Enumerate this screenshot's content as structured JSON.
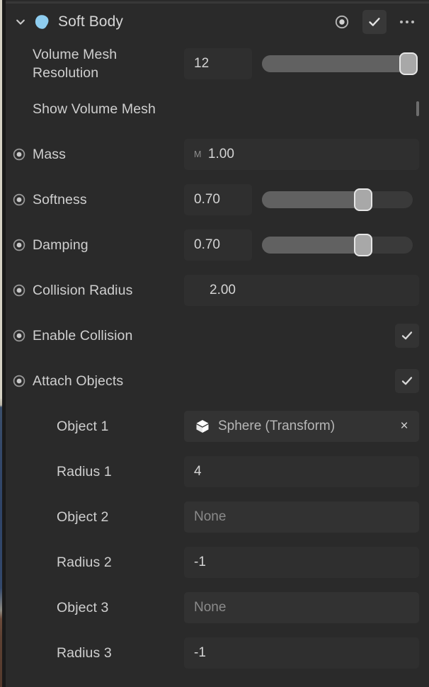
{
  "colors": {
    "panel_bg": "#2a2a2a",
    "field_bg": "#2f2f2f",
    "objfield_bg": "#333333",
    "text": "#cfcfcf",
    "muted_text": "#8b8b8b",
    "accent_icon": "#8ecdf0",
    "slider_fill": "#616161",
    "slider_knob": "#a8a8a8"
  },
  "header": {
    "title": "Soft Body",
    "foldout_state": "expanded",
    "foldout_icon": "chevron-down-icon",
    "component_icon": "soft-body-blob-icon",
    "target_icon": "record-target-icon",
    "enabled_icon": "checkmark-icon",
    "menu_icon": "more-options-icon"
  },
  "properties": [
    {
      "name": "volume-mesh-resolution",
      "label": "Volume Mesh Resolution",
      "control": "number-slider",
      "has_bullet": false,
      "value": "12",
      "slider": {
        "percent": 97
      }
    },
    {
      "name": "show-volume-mesh",
      "label": "Show Volume Mesh",
      "control": "checkbox",
      "has_bullet": false,
      "checked": false
    },
    {
      "name": "mass",
      "label": "Mass",
      "control": "number-unit",
      "has_bullet": true,
      "unit": "M",
      "value": "1.00"
    },
    {
      "name": "softness",
      "label": "Softness",
      "control": "number-slider",
      "has_bullet": true,
      "value": "0.70",
      "slider": {
        "percent": 67
      }
    },
    {
      "name": "damping",
      "label": "Damping",
      "control": "number-slider",
      "has_bullet": true,
      "value": "0.70",
      "slider": {
        "percent": 67
      }
    },
    {
      "name": "collision-radius",
      "label": "Collision Radius",
      "control": "number-wide",
      "has_bullet": true,
      "value": "2.00"
    },
    {
      "name": "enable-collision",
      "label": "Enable Collision",
      "control": "checkmark",
      "has_bullet": true,
      "checked": true
    },
    {
      "name": "attach-objects",
      "label": "Attach Objects",
      "control": "checkmark",
      "has_bullet": true,
      "checked": true
    },
    {
      "name": "object-1",
      "label": "Object 1",
      "control": "object-ref",
      "has_bullet": false,
      "indent": true,
      "value": "Sphere (Transform)",
      "object_icon": "prefab-cube-icon",
      "clear_label": "×",
      "empty": false
    },
    {
      "name": "radius-1",
      "label": "Radius 1",
      "control": "number-wide-full",
      "has_bullet": false,
      "indent": true,
      "value": "4"
    },
    {
      "name": "object-2",
      "label": "Object 2",
      "control": "object-ref",
      "has_bullet": false,
      "indent": true,
      "value": "None",
      "empty": true
    },
    {
      "name": "radius-2",
      "label": "Radius 2",
      "control": "number-wide-full",
      "has_bullet": false,
      "indent": true,
      "value": "-1"
    },
    {
      "name": "object-3",
      "label": "Object 3",
      "control": "object-ref",
      "has_bullet": false,
      "indent": true,
      "value": "None",
      "empty": true
    },
    {
      "name": "radius-3",
      "label": "Radius 3",
      "control": "number-wide-full",
      "has_bullet": false,
      "indent": true,
      "value": "-1"
    }
  ]
}
